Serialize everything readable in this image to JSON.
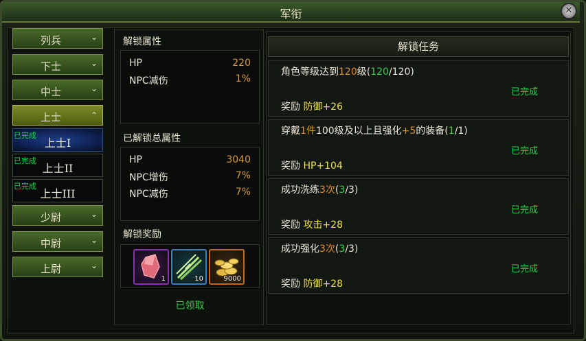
{
  "window": {
    "title": "军衔",
    "close_icon": "close-icon"
  },
  "ranks": [
    {
      "label": "列兵",
      "expanded": false
    },
    {
      "label": "下士",
      "expanded": false
    },
    {
      "label": "中士",
      "expanded": false
    },
    {
      "label": "上士",
      "expanded": true
    },
    {
      "label": "少尉",
      "expanded": false
    },
    {
      "label": "中尉",
      "expanded": false
    },
    {
      "label": "上尉",
      "expanded": false
    }
  ],
  "sub_ranks": [
    {
      "label": "上士I",
      "status": "已完成",
      "selected": true
    },
    {
      "label": "上士II",
      "status": "已完成",
      "selected": false
    },
    {
      "label": "上士III",
      "status": "已完成",
      "selected": false
    }
  ],
  "unlock_attrs": {
    "title": "解锁属性",
    "rows": [
      {
        "key": "HP",
        "value": "220"
      },
      {
        "key": "NPC减伤",
        "value": "1%"
      }
    ]
  },
  "total_attrs": {
    "title": "已解锁总属性",
    "rows": [
      {
        "key": "HP",
        "value": "3040"
      },
      {
        "key": "NPC增伤",
        "value": "7%"
      },
      {
        "key": "NPC减伤",
        "value": "7%"
      }
    ]
  },
  "rewards": {
    "title": "解锁奖励",
    "items": [
      {
        "icon": "red-crystal-icon",
        "count": "1",
        "border": "#8a2fb0"
      },
      {
        "icon": "green-blades-icon",
        "count": "10",
        "border": "#3a7fc0"
      },
      {
        "icon": "gold-coins-icon",
        "count": "9000",
        "border": "#c06a20"
      }
    ],
    "status": "已领取"
  },
  "tasks_header": "解锁任务",
  "reward_label": "奖励",
  "tasks": [
    {
      "desc_parts": [
        {
          "text": "角色等级达到",
          "c": ""
        },
        {
          "text": "120",
          "c": "o"
        },
        {
          "text": "级(",
          "c": ""
        },
        {
          "text": "120",
          "c": "g"
        },
        {
          "text": "/120)",
          "c": ""
        }
      ],
      "reward": "防御+26",
      "status": "已完成"
    },
    {
      "desc_parts": [
        {
          "text": "穿戴",
          "c": ""
        },
        {
          "text": "1件",
          "c": "o"
        },
        {
          "text": "100级及以上且强化",
          "c": ""
        },
        {
          "text": "+5",
          "c": "o"
        },
        {
          "text": "的装备(",
          "c": ""
        },
        {
          "text": "1",
          "c": "g"
        },
        {
          "text": "/1)",
          "c": ""
        }
      ],
      "reward": "HP+104",
      "status": "已完成"
    },
    {
      "desc_parts": [
        {
          "text": "成功洗练",
          "c": ""
        },
        {
          "text": "3次",
          "c": "o"
        },
        {
          "text": "(",
          "c": ""
        },
        {
          "text": "3",
          "c": "g"
        },
        {
          "text": "/3)",
          "c": ""
        }
      ],
      "reward": "攻击+28",
      "status": "已完成"
    },
    {
      "desc_parts": [
        {
          "text": "成功强化",
          "c": ""
        },
        {
          "text": "3次",
          "c": "o"
        },
        {
          "text": "(",
          "c": ""
        },
        {
          "text": "3",
          "c": "g"
        },
        {
          "text": "/3)",
          "c": ""
        }
      ],
      "reward": "防御+28",
      "status": "已完成"
    }
  ]
}
